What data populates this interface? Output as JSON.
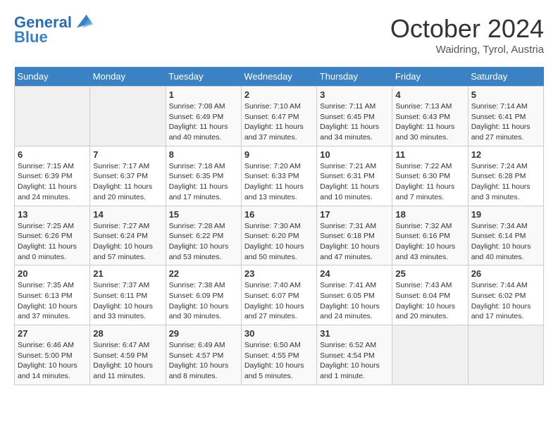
{
  "header": {
    "logo_line1": "General",
    "logo_line2": "Blue",
    "month": "October 2024",
    "location": "Waidring, Tyrol, Austria"
  },
  "days_of_week": [
    "Sunday",
    "Monday",
    "Tuesday",
    "Wednesday",
    "Thursday",
    "Friday",
    "Saturday"
  ],
  "weeks": [
    [
      {
        "day": "",
        "sunrise": "",
        "sunset": "",
        "daylight": ""
      },
      {
        "day": "",
        "sunrise": "",
        "sunset": "",
        "daylight": ""
      },
      {
        "day": "1",
        "sunrise": "Sunrise: 7:08 AM",
        "sunset": "Sunset: 6:49 PM",
        "daylight": "Daylight: 11 hours and 40 minutes."
      },
      {
        "day": "2",
        "sunrise": "Sunrise: 7:10 AM",
        "sunset": "Sunset: 6:47 PM",
        "daylight": "Daylight: 11 hours and 37 minutes."
      },
      {
        "day": "3",
        "sunrise": "Sunrise: 7:11 AM",
        "sunset": "Sunset: 6:45 PM",
        "daylight": "Daylight: 11 hours and 34 minutes."
      },
      {
        "day": "4",
        "sunrise": "Sunrise: 7:13 AM",
        "sunset": "Sunset: 6:43 PM",
        "daylight": "Daylight: 11 hours and 30 minutes."
      },
      {
        "day": "5",
        "sunrise": "Sunrise: 7:14 AM",
        "sunset": "Sunset: 6:41 PM",
        "daylight": "Daylight: 11 hours and 27 minutes."
      }
    ],
    [
      {
        "day": "6",
        "sunrise": "Sunrise: 7:15 AM",
        "sunset": "Sunset: 6:39 PM",
        "daylight": "Daylight: 11 hours and 24 minutes."
      },
      {
        "day": "7",
        "sunrise": "Sunrise: 7:17 AM",
        "sunset": "Sunset: 6:37 PM",
        "daylight": "Daylight: 11 hours and 20 minutes."
      },
      {
        "day": "8",
        "sunrise": "Sunrise: 7:18 AM",
        "sunset": "Sunset: 6:35 PM",
        "daylight": "Daylight: 11 hours and 17 minutes."
      },
      {
        "day": "9",
        "sunrise": "Sunrise: 7:20 AM",
        "sunset": "Sunset: 6:33 PM",
        "daylight": "Daylight: 11 hours and 13 minutes."
      },
      {
        "day": "10",
        "sunrise": "Sunrise: 7:21 AM",
        "sunset": "Sunset: 6:31 PM",
        "daylight": "Daylight: 11 hours and 10 minutes."
      },
      {
        "day": "11",
        "sunrise": "Sunrise: 7:22 AM",
        "sunset": "Sunset: 6:30 PM",
        "daylight": "Daylight: 11 hours and 7 minutes."
      },
      {
        "day": "12",
        "sunrise": "Sunrise: 7:24 AM",
        "sunset": "Sunset: 6:28 PM",
        "daylight": "Daylight: 11 hours and 3 minutes."
      }
    ],
    [
      {
        "day": "13",
        "sunrise": "Sunrise: 7:25 AM",
        "sunset": "Sunset: 6:26 PM",
        "daylight": "Daylight: 11 hours and 0 minutes."
      },
      {
        "day": "14",
        "sunrise": "Sunrise: 7:27 AM",
        "sunset": "Sunset: 6:24 PM",
        "daylight": "Daylight: 10 hours and 57 minutes."
      },
      {
        "day": "15",
        "sunrise": "Sunrise: 7:28 AM",
        "sunset": "Sunset: 6:22 PM",
        "daylight": "Daylight: 10 hours and 53 minutes."
      },
      {
        "day": "16",
        "sunrise": "Sunrise: 7:30 AM",
        "sunset": "Sunset: 6:20 PM",
        "daylight": "Daylight: 10 hours and 50 minutes."
      },
      {
        "day": "17",
        "sunrise": "Sunrise: 7:31 AM",
        "sunset": "Sunset: 6:18 PM",
        "daylight": "Daylight: 10 hours and 47 minutes."
      },
      {
        "day": "18",
        "sunrise": "Sunrise: 7:32 AM",
        "sunset": "Sunset: 6:16 PM",
        "daylight": "Daylight: 10 hours and 43 minutes."
      },
      {
        "day": "19",
        "sunrise": "Sunrise: 7:34 AM",
        "sunset": "Sunset: 6:14 PM",
        "daylight": "Daylight: 10 hours and 40 minutes."
      }
    ],
    [
      {
        "day": "20",
        "sunrise": "Sunrise: 7:35 AM",
        "sunset": "Sunset: 6:13 PM",
        "daylight": "Daylight: 10 hours and 37 minutes."
      },
      {
        "day": "21",
        "sunrise": "Sunrise: 7:37 AM",
        "sunset": "Sunset: 6:11 PM",
        "daylight": "Daylight: 10 hours and 33 minutes."
      },
      {
        "day": "22",
        "sunrise": "Sunrise: 7:38 AM",
        "sunset": "Sunset: 6:09 PM",
        "daylight": "Daylight: 10 hours and 30 minutes."
      },
      {
        "day": "23",
        "sunrise": "Sunrise: 7:40 AM",
        "sunset": "Sunset: 6:07 PM",
        "daylight": "Daylight: 10 hours and 27 minutes."
      },
      {
        "day": "24",
        "sunrise": "Sunrise: 7:41 AM",
        "sunset": "Sunset: 6:05 PM",
        "daylight": "Daylight: 10 hours and 24 minutes."
      },
      {
        "day": "25",
        "sunrise": "Sunrise: 7:43 AM",
        "sunset": "Sunset: 6:04 PM",
        "daylight": "Daylight: 10 hours and 20 minutes."
      },
      {
        "day": "26",
        "sunrise": "Sunrise: 7:44 AM",
        "sunset": "Sunset: 6:02 PM",
        "daylight": "Daylight: 10 hours and 17 minutes."
      }
    ],
    [
      {
        "day": "27",
        "sunrise": "Sunrise: 6:46 AM",
        "sunset": "Sunset: 5:00 PM",
        "daylight": "Daylight: 10 hours and 14 minutes."
      },
      {
        "day": "28",
        "sunrise": "Sunrise: 6:47 AM",
        "sunset": "Sunset: 4:59 PM",
        "daylight": "Daylight: 10 hours and 11 minutes."
      },
      {
        "day": "29",
        "sunrise": "Sunrise: 6:49 AM",
        "sunset": "Sunset: 4:57 PM",
        "daylight": "Daylight: 10 hours and 8 minutes."
      },
      {
        "day": "30",
        "sunrise": "Sunrise: 6:50 AM",
        "sunset": "Sunset: 4:55 PM",
        "daylight": "Daylight: 10 hours and 5 minutes."
      },
      {
        "day": "31",
        "sunrise": "Sunrise: 6:52 AM",
        "sunset": "Sunset: 4:54 PM",
        "daylight": "Daylight: 10 hours and 1 minute."
      },
      {
        "day": "",
        "sunrise": "",
        "sunset": "",
        "daylight": ""
      },
      {
        "day": "",
        "sunrise": "",
        "sunset": "",
        "daylight": ""
      }
    ]
  ]
}
